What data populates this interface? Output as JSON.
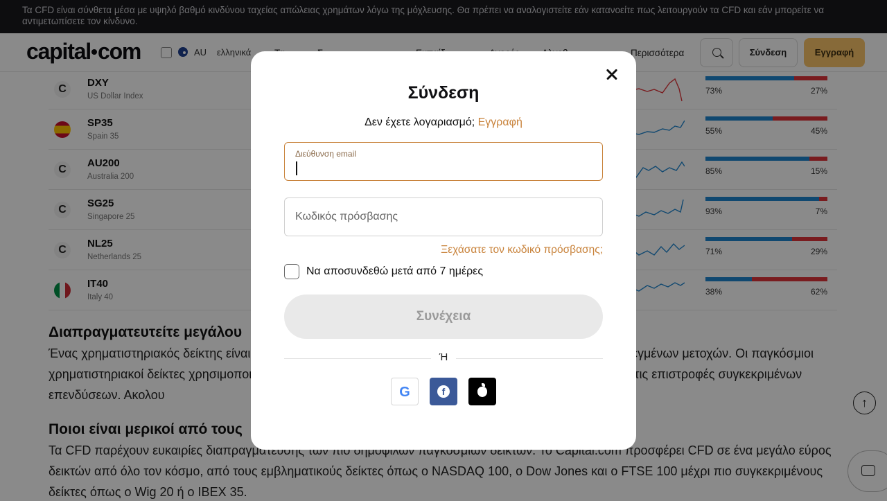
{
  "risk_banner": "Τα CFD είναι σύνθετα μέσα με υψηλό βαθμό κινδύνου ταχείας απώλειας χρημάτων λόγω της μόχλευσης. Θα πρέπει να αναλογιστείτε εάν κατανοείτε πως λειτουργούν τα CFD και εάν μπορείτε να αντιμετωπίσετε τον κίνδυνο.",
  "header": {
    "logo": "capital",
    "logo_tld": "com",
    "region": "AU",
    "language": "ελληνικά",
    "nav": [
      "Τα",
      "Σ",
      "Εκπαίδ",
      "Αγορές",
      "Αλγοβ",
      "Περισσότερα"
    ],
    "login_label": "Σύνδεση",
    "signup_label": "Εγγραφή"
  },
  "markets": [
    {
      "symbol": "DXY",
      "name": "US Dollar Index",
      "icon": "capital-icon",
      "buy": 73,
      "buy_label": "73%",
      "sell_label": "27%"
    },
    {
      "symbol": "SP35",
      "name": "Spain 35",
      "icon": "spain-flag-icon",
      "buy": 55,
      "buy_label": "55%",
      "sell_label": "45%"
    },
    {
      "symbol": "AU200",
      "name": "Australia 200",
      "icon": "capital-icon",
      "buy": 85,
      "buy_label": "85%",
      "sell_label": "15%"
    },
    {
      "symbol": "SG25",
      "name": "Singapore 25",
      "icon": "capital-icon",
      "buy": 93,
      "buy_label": "93%",
      "sell_label": "7%"
    },
    {
      "symbol": "NL25",
      "name": "Netherlands 25",
      "icon": "capital-icon",
      "buy": 71,
      "buy_label": "71%",
      "sell_label": "29%"
    },
    {
      "symbol": "IT40",
      "name": "Italy 40",
      "icon": "italy-flag-icon",
      "buy": 38,
      "buy_label": "38%",
      "sell_label": "62%"
    }
  ],
  "article": {
    "heading1": "Διαπραγματευτείτε μεγάλου",
    "para1": "Ένας χρηματιστηριακός δείκτης είναι                                                                                                         πιλεγμένων μετοχών. Οι παγκόσμιοι χρηματιστηριακοί δείκτες χρησιμοποι                                                                                                   ρίνουν τις επιστροφές συγκεκριμένων επενδύσεων. Ακολου                                                                                                    ο στο Capital.com.",
    "heading2": "Ποιοι είναι μερικοί από τους",
    "para2": "Τα CFD παρέχουν ευκαιρίες διαπραγματευσης των πιο δημοφιλών παγκόσμιων δεικτών. Το Capital.com προσφέρει CFD σε ένα μεγάλο εύρος δεικτών από όλο τον κόσμο, από τους εμβληματικούς δείκτες όπως ο NASDAQ 100, ο Dow Jones και ο FTSE 100 μέχρι πιο συγκεκριμένους δείκτες όπως ο Wig 20 ή ο IBEX 35."
  },
  "modal": {
    "title": "Σύνδεση",
    "no_account": "Δεν έχετε λογαριασμό;",
    "register_link": "Εγγραφή",
    "email_label": "Διεύθυνση email",
    "email_value": "",
    "password_placeholder": "Κωδικός πρόσβασης",
    "forgot": "Ξεχάσατε τον κωδικό πρόσβασης;",
    "remember_label": "Να αποσυνδεθώ μετά από 7 ημέρες",
    "remember_checked": false,
    "continue_label": "Συνέχεια",
    "or_label": "Ή",
    "social": [
      "google-icon",
      "facebook-icon",
      "apple-icon"
    ]
  },
  "colors": {
    "accent": "#c8823a",
    "signup_button": "#f9c56a",
    "buy_bar": "#1f86cf",
    "sell_bar": "#e0353a",
    "facebook": "#3b5998"
  }
}
